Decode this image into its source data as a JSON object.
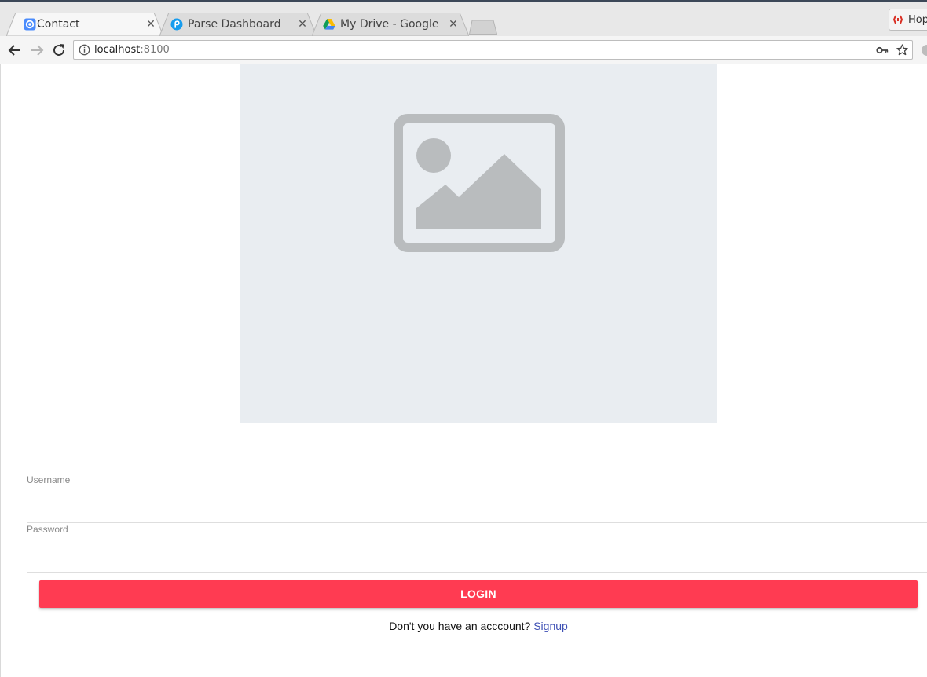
{
  "browser": {
    "tabs": [
      {
        "title": "Contact",
        "icon": "ionic-icon",
        "active": true
      },
      {
        "title": "Parse Dashboard",
        "icon": "parse-icon",
        "active": false
      },
      {
        "title": "My Drive - Google D",
        "icon": "google-drive-icon",
        "active": false
      }
    ],
    "extension_label": "Hop",
    "address": {
      "host": "localhost",
      "port": ":8100"
    }
  },
  "page": {
    "hero_image": "image-placeholder-icon",
    "form": {
      "username_label": "Username",
      "username_value": "",
      "password_label": "Password",
      "password_value": ""
    },
    "login_button": "LOGIN",
    "signup_prompt": "Don't you have an acccount?",
    "signup_link": "Signup"
  },
  "colors": {
    "accent": "#ff3b52",
    "link": "#3f51b5",
    "hero_bg": "#e9edf1",
    "placeholder_icon": "#b9bcbe"
  }
}
